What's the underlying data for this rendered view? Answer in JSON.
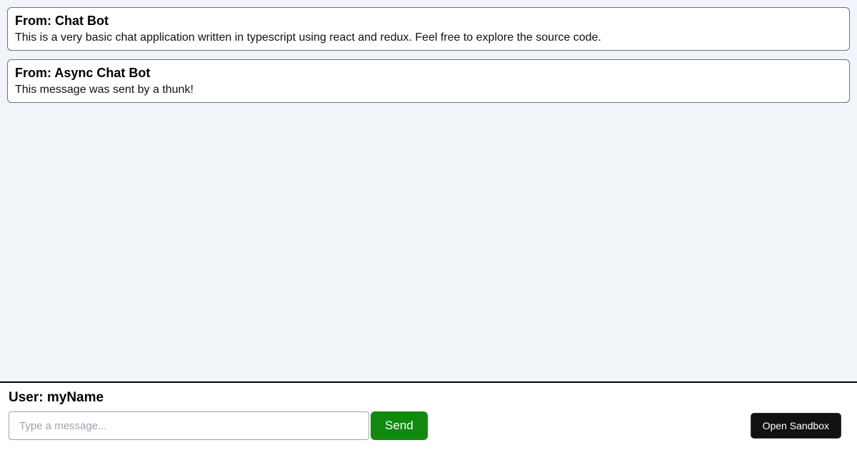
{
  "messages": [
    {
      "from_prefix": "From: ",
      "from_name": "Chat Bot",
      "body": "This is a very basic chat application written in typescript using react and redux. Feel free to explore the source code."
    },
    {
      "from_prefix": "From: ",
      "from_name": "Async Chat Bot",
      "body": "This message was sent by a thunk!"
    }
  ],
  "composer": {
    "user_label_prefix": "User: ",
    "user_name": "myName",
    "placeholder": "Type a message...",
    "send_label": "Send"
  },
  "footer": {
    "open_sandbox_label": "Open Sandbox"
  }
}
